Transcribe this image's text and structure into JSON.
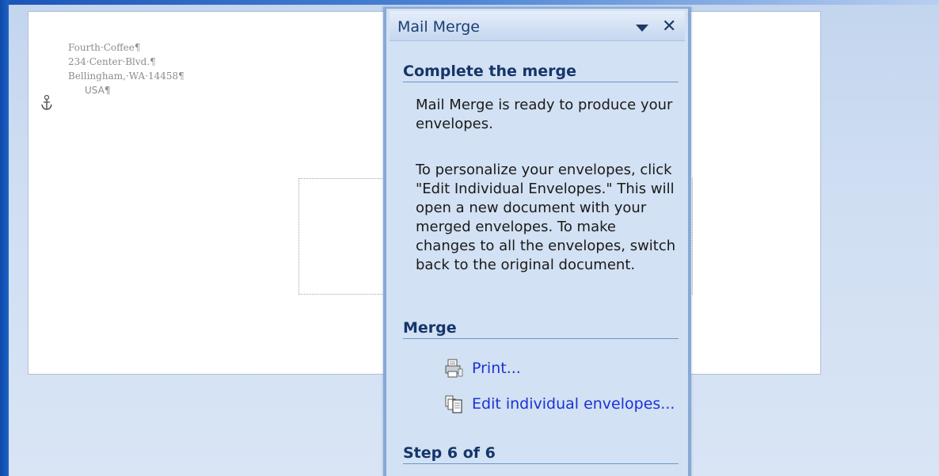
{
  "document": {
    "return_address": {
      "line1": "Fourth·Coffee¶",
      "line2": "234·Center·Blvd.¶",
      "line3": "Bellingham,·WA·14458¶",
      "line4": "USA¶"
    }
  },
  "task_pane": {
    "title": "Mail Merge",
    "sections": {
      "complete": {
        "heading": "Complete the merge",
        "para1": "Mail Merge is ready to produce your envelopes.",
        "para2": "To personalize your envelopes, click \"Edit Individual Envelopes.\" This will open a new document with your merged envelopes. To make changes to all the envelopes, switch back to the original document."
      },
      "merge": {
        "heading": "Merge",
        "print_label": "Print...",
        "edit_label": "Edit individual envelopes..."
      },
      "step": {
        "heading": "Step 6 of 6"
      }
    }
  }
}
